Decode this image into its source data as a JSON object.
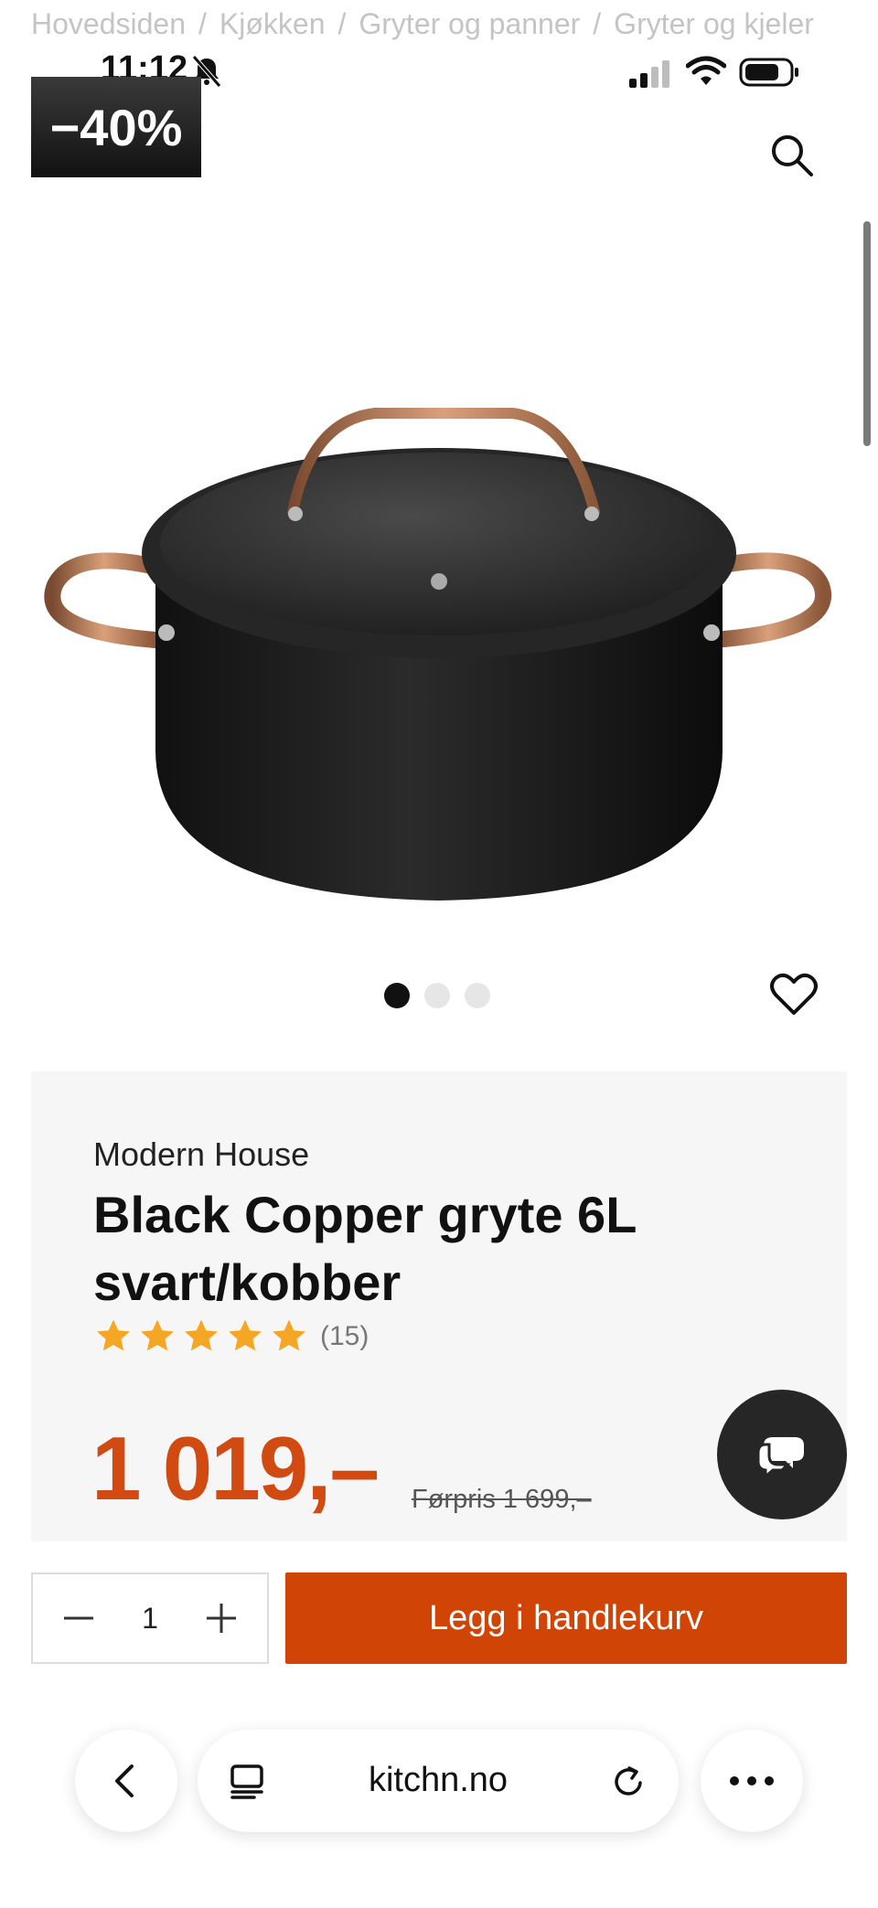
{
  "breadcrumb": [
    "Hovedsiden",
    "Kjøkken",
    "Gryter og panner",
    "Gryter og kjeler"
  ],
  "status_bar": {
    "time": "11:12"
  },
  "badge": {
    "discount": "−40%"
  },
  "icons": {
    "search": "search-icon",
    "bell": "bell-muted-icon",
    "heart": "heart-icon",
    "chat": "chat-icon",
    "back": "chevron-left-icon",
    "tabs": "tabs-icon",
    "reload": "reload-icon",
    "more": "more-icon"
  },
  "carousel": {
    "count": 3,
    "active": 0
  },
  "product": {
    "brand": "Modern House",
    "title": "Black Copper gryte 6L svart/kobber",
    "rating_stars": 5,
    "review_count": "(15)",
    "price": "1 019,–",
    "old_price": "Førpris 1 699,–"
  },
  "cart": {
    "quantity": "1",
    "add_label": "Legg i handlekurv"
  },
  "browser": {
    "url": "kitchn.no"
  },
  "colors": {
    "accent": "#d04405",
    "price": "#d04a12",
    "star": "#f5a623",
    "card_bg": "#f6f6f6"
  }
}
